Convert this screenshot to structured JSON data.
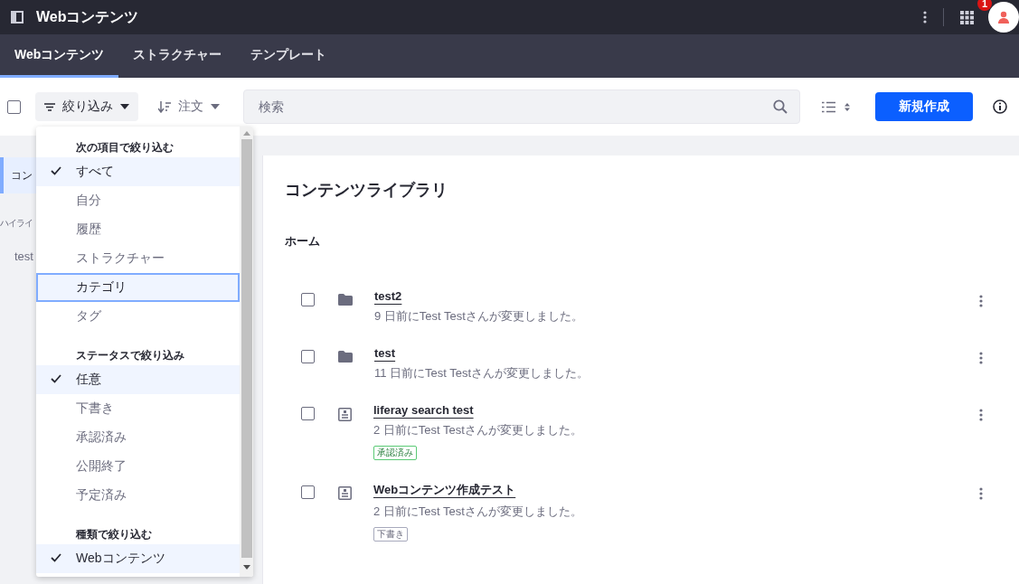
{
  "header": {
    "title": "Webコンテンツ",
    "notification_count": "1"
  },
  "tabs": [
    {
      "label": "Webコンテンツ",
      "selected": true
    },
    {
      "label": "ストラクチャー",
      "selected": false
    },
    {
      "label": "テンプレート",
      "selected": false
    }
  ],
  "toolbar": {
    "select_all_checked": false,
    "filter_label": "絞り込み",
    "order_label": "注文",
    "search": {
      "placeholder": "検索"
    },
    "new_button": "新規作成"
  },
  "sidebar": {
    "items": [
      {
        "label": "コン",
        "selected": true
      }
    ],
    "section_title": "ハイライ",
    "tags": [
      "test"
    ]
  },
  "filter_menu": {
    "sections": [
      {
        "title": "次の項目で絞り込む",
        "items": [
          {
            "label": "すべて",
            "checked": true,
            "focused": false
          },
          {
            "label": "自分",
            "checked": false,
            "focused": false
          },
          {
            "label": "履歴",
            "checked": false,
            "focused": false
          },
          {
            "label": "ストラクチャー",
            "checked": false,
            "focused": false
          },
          {
            "label": "カテゴリ",
            "checked": false,
            "focused": true
          },
          {
            "label": "タグ",
            "checked": false,
            "focused": false
          }
        ]
      },
      {
        "title": "ステータスで絞り込み",
        "items": [
          {
            "label": "任意",
            "checked": true,
            "focused": false
          },
          {
            "label": "下書き",
            "checked": false,
            "focused": false
          },
          {
            "label": "承認済み",
            "checked": false,
            "focused": false
          },
          {
            "label": "公開終了",
            "checked": false,
            "focused": false
          },
          {
            "label": "予定済み",
            "checked": false,
            "focused": false
          }
        ]
      },
      {
        "title": "種類で絞り込む",
        "items": [
          {
            "label": "Webコンテンツ",
            "checked": true,
            "focused": false
          }
        ]
      }
    ]
  },
  "library": {
    "title": "コンテンツライブラリ",
    "breadcrumb": "ホーム",
    "entries": [
      {
        "kind": "folder",
        "title": "test2",
        "checked": false,
        "subtitle": "9 日前にTest Testさんが変更しました。"
      },
      {
        "kind": "folder",
        "title": "test",
        "checked": false,
        "subtitle": "11 日前にTest Testさんが変更しました。"
      },
      {
        "kind": "article",
        "title": "liferay search test",
        "checked": false,
        "subtitle": "2 日前にTest Testさんが変更しました。",
        "status": {
          "label": "承認済み",
          "kind": "approved"
        }
      },
      {
        "kind": "article",
        "title": "Webコンテンツ作成テスト",
        "checked": false,
        "subtitle": "2 日前にTest Testさんが変更しました。",
        "status": {
          "label": "下書き",
          "kind": "draft"
        }
      }
    ]
  }
}
